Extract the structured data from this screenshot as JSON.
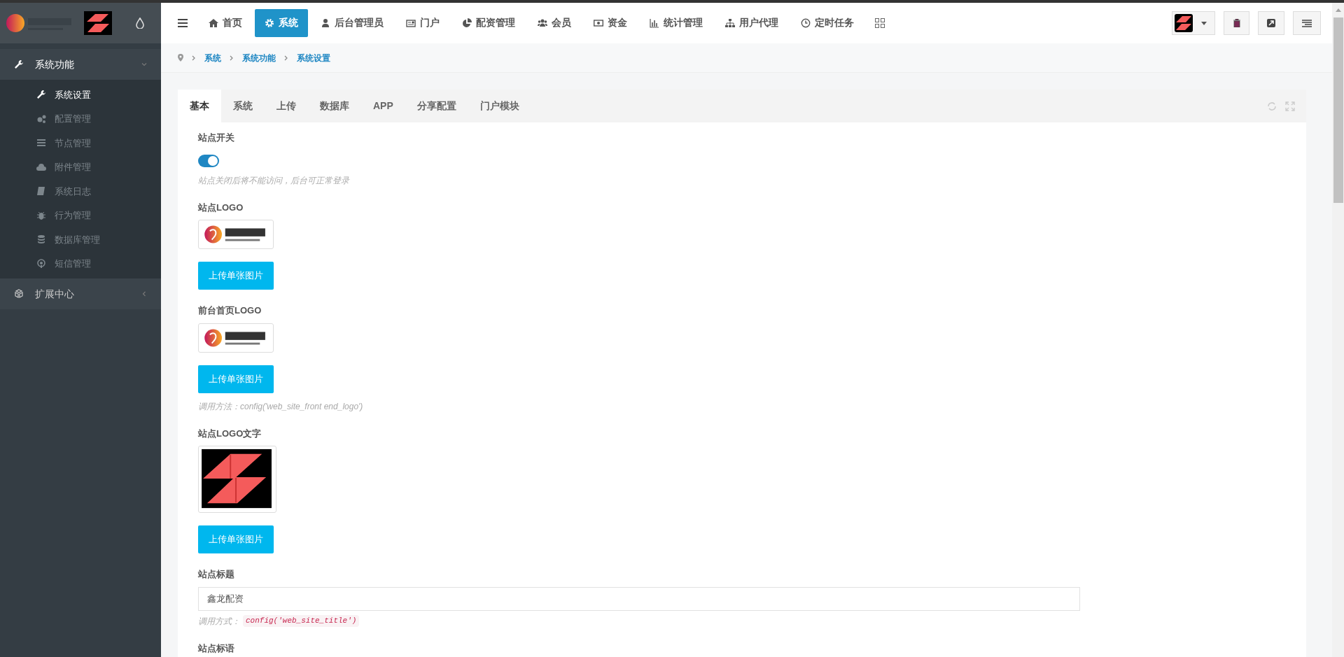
{
  "sidebar": {
    "groups": [
      {
        "label": "系统功能",
        "expanded": true,
        "items": [
          {
            "label": "系统设置",
            "selected": true
          },
          {
            "label": "配置管理",
            "selected": false
          },
          {
            "label": "节点管理",
            "selected": false
          },
          {
            "label": "附件管理",
            "selected": false
          },
          {
            "label": "系统日志",
            "selected": false
          },
          {
            "label": "行为管理",
            "selected": false
          },
          {
            "label": "数据库管理",
            "selected": false
          },
          {
            "label": "短信管理",
            "selected": false
          }
        ]
      },
      {
        "label": "扩展中心",
        "expanded": false
      }
    ]
  },
  "top_nav": [
    {
      "label": "首页",
      "selected": false
    },
    {
      "label": "系统",
      "selected": true
    },
    {
      "label": "后台管理员",
      "selected": false
    },
    {
      "label": "门户",
      "selected": false
    },
    {
      "label": "配资管理",
      "selected": false
    },
    {
      "label": "会员",
      "selected": false
    },
    {
      "label": "资金",
      "selected": false
    },
    {
      "label": "统计管理",
      "selected": false
    },
    {
      "label": "用户代理",
      "selected": false
    },
    {
      "label": "定时任务",
      "selected": false
    }
  ],
  "breadcrumb": [
    "系统",
    "系统功能",
    "系统设置"
  ],
  "tabs": [
    {
      "label": "基本",
      "selected": true
    },
    {
      "label": "系统",
      "selected": false
    },
    {
      "label": "上传",
      "selected": false
    },
    {
      "label": "数据库",
      "selected": false
    },
    {
      "label": "APP",
      "selected": false
    },
    {
      "label": "分享配置",
      "selected": false
    },
    {
      "label": "门户模块",
      "selected": false
    }
  ],
  "fields": [
    {
      "kind": "switch",
      "label": "站点开关",
      "on": true,
      "hint": "站点关闭后将不能访问，后台可正常登录"
    },
    {
      "kind": "image",
      "label": "站点LOGO",
      "button": "上传单张图片"
    },
    {
      "kind": "image",
      "label": "前台首页LOGO",
      "button": "上传单张图片",
      "hint": "调用方法：config('web_site_front end_logo')"
    },
    {
      "kind": "image",
      "label": "站点LOGO文字",
      "button": "上传单张图片"
    },
    {
      "kind": "text",
      "label": "站点标题",
      "value": "鑫龙配资",
      "hint": "调用方式：",
      "code": "config('web_site_title')"
    },
    {
      "kind": "label",
      "label": "站点标语"
    }
  ]
}
